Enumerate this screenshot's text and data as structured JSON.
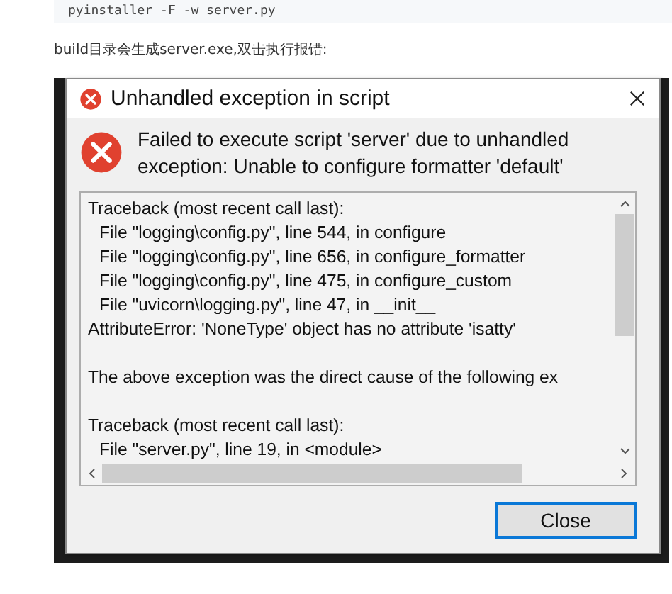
{
  "code_block": {
    "command": "pyinstaller -F -w server.py"
  },
  "paragraph": "build目录会生成server.exe,双击执行报错:",
  "dialog": {
    "title": "Unhandled exception in script",
    "message": "Failed to execute script 'server' due to unhandled exception: Unable to configure formatter 'default'",
    "detail_blocks": [
      {
        "lines": [
          {
            "text": "Traceback (most recent call last):",
            "indented": false
          },
          {
            "text": "File \"logging\\config.py\", line 544, in configure",
            "indented": true
          },
          {
            "text": "File \"logging\\config.py\", line 656, in configure_formatter",
            "indented": true
          },
          {
            "text": "File \"logging\\config.py\", line 475, in configure_custom",
            "indented": true
          },
          {
            "text": "File \"uvicorn\\logging.py\", line 47, in __init__",
            "indented": true
          },
          {
            "text": "AttributeError: 'NoneType' object has no attribute 'isatty'",
            "indented": false
          }
        ]
      },
      {
        "lines": [
          {
            "text": "The above exception was the direct cause of the following ex",
            "indented": false
          }
        ]
      },
      {
        "lines": [
          {
            "text": "Traceback (most recent call last):",
            "indented": false
          },
          {
            "text": "File \"server.py\", line 19, in <module>",
            "indented": true
          }
        ]
      }
    ],
    "button": {
      "label": "Close",
      "focused": true
    }
  }
}
